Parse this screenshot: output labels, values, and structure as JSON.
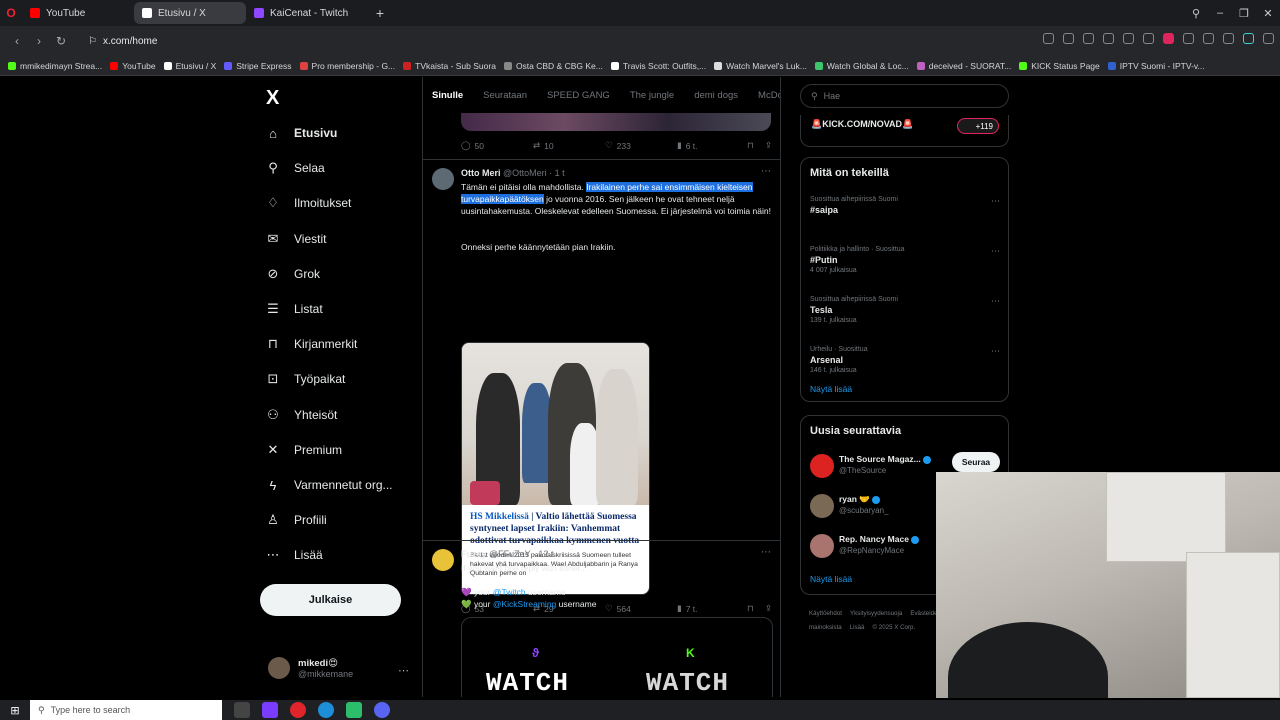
{
  "browser": {
    "tabs": [
      {
        "label": "YouTube",
        "color": "#ff0000",
        "active": false
      },
      {
        "label": "Etusivu / X",
        "color": "#ffffff",
        "active": true
      },
      {
        "label": "KaiCenat - Twitch",
        "color": "#9146ff",
        "active": false
      }
    ],
    "url": "x.com/home",
    "bookmarks": [
      {
        "label": "mmikedimayn Strea...",
        "color": "#53fc18"
      },
      {
        "label": "YouTube",
        "color": "#ff0000"
      },
      {
        "label": "Etusivu / X",
        "color": "#ffffff"
      },
      {
        "label": "Stripe Express",
        "color": "#635bff"
      },
      {
        "label": "Pro membership - G...",
        "color": "#e04040"
      },
      {
        "label": "TVkaista - Sub Suora",
        "color": "#cc2222"
      },
      {
        "label": "Osta CBD & CBG Ke...",
        "color": "#888888"
      },
      {
        "label": "Travis Scott: Outfits,...",
        "color": "#ffffff"
      },
      {
        "label": "Watch Marvel's Luk...",
        "color": "#dddddd"
      },
      {
        "label": "Watch Global & Loc...",
        "color": "#3ec46d"
      },
      {
        "label": "deceived - SUORAT...",
        "color": "#c060c0"
      },
      {
        "label": "KICK Status Page",
        "color": "#53fc18"
      },
      {
        "label": "IPTV Suomi - IPTV-v...",
        "color": "#3060d0"
      }
    ]
  },
  "nav": {
    "logo": "X",
    "items": [
      {
        "label": "Etusivu",
        "icon": "home-icon",
        "glyph": "⌂",
        "active": true
      },
      {
        "label": "Selaa",
        "icon": "search-icon",
        "glyph": "⚲"
      },
      {
        "label": "Ilmoitukset",
        "icon": "bell-icon",
        "glyph": "♢"
      },
      {
        "label": "Viestit",
        "icon": "mail-icon",
        "glyph": "✉"
      },
      {
        "label": "Grok",
        "icon": "grok-icon",
        "glyph": "⊘"
      },
      {
        "label": "Listat",
        "icon": "list-icon",
        "glyph": "☰"
      },
      {
        "label": "Kirjanmerkit",
        "icon": "bookmark-icon",
        "glyph": "⊓"
      },
      {
        "label": "Työpaikat",
        "icon": "briefcase-icon",
        "glyph": "⊡"
      },
      {
        "label": "Yhteisöt",
        "icon": "communities-icon",
        "glyph": "⚇"
      },
      {
        "label": "Premium",
        "icon": "x-icon",
        "glyph": "✕"
      },
      {
        "label": "Varmennetut org...",
        "icon": "lightning-icon",
        "glyph": "ϟ"
      },
      {
        "label": "Profiili",
        "icon": "profile-icon",
        "glyph": "♙"
      },
      {
        "label": "Lisää",
        "icon": "more-icon",
        "glyph": "⋯"
      }
    ],
    "post_label": "Julkaise",
    "account": {
      "name": "mikedi😍",
      "handle": "@mikkemane"
    }
  },
  "feed": {
    "tabs": [
      "Sinulle",
      "Seurataan",
      "SPEED GANG",
      "The jungle",
      "demi dogs",
      "McDonal"
    ],
    "top_actions": {
      "replies": "50",
      "reposts": "10",
      "likes": "233",
      "views": "6 t."
    },
    "tweet1": {
      "name": "Otto Meri",
      "handle": "@OttoMeri · 1 t",
      "text_a": "Tämän ei pitäisi olla mahdollista. ",
      "text_hl": "Irakilainen perhe sai ensimmäisen kielteisen turvapaikkapäätöksen",
      "text_b": " jo vuonna 2016. Sen jälkeen he ovat tehneet neljä uusintahakemusta. Oleskelevat edelleen Suomessa. Ei järjestelmä voi toimia näin!",
      "text_c": "Onneksi perhe käännytetään pian Irakiin.",
      "card_category": "HS Mikkelissä",
      "card_title": " | Valtio lähettää Suomessa syntyneet lapset Irakiin: Vanhemmat odottivat turvapaikkaa kymmenen vuotta",
      "card_sub": "Sadat vuoden 2015 pakolaiskriisissä Suomeen tulleet hakevat yhä turvapaikkaa. Wael Abduljabbarin ja Ranya Qubtanin perhe on",
      "actions": {
        "replies": "53",
        "reposts": "29",
        "likes": "564",
        "views": "7 t."
      }
    },
    "tweet2": {
      "name": "Fuzey",
      "handle": "@FFuZeY · 12 t",
      "line1": "If you want one reply with either...",
      "line2a": "💜 your ",
      "line2link": "@Twitch",
      "line2b": " username",
      "line3a": "💚 your ",
      "line3link": "@KickStreaming",
      "line3b": " username",
      "watch_left": "WATCH",
      "watch_right": "WATCH"
    }
  },
  "right": {
    "search_placeholder": "Hae",
    "live_text": "🚨KICK.COM/NOVAD🚨",
    "live_count": "+119",
    "trends_title": "Mitä on tekeillä",
    "trends": [
      {
        "meta": "Suosittua aihepiirissä Suomi",
        "name": "#saipa",
        "count": ""
      },
      {
        "meta": "Politiikka ja hallinto · Suosittua",
        "name": "#Putin",
        "count": "4 007 julkaisua"
      },
      {
        "meta": "Suosittua aihepiirissä Suomi",
        "name": "Tesla",
        "count": "139 t. julkaisua"
      },
      {
        "meta": "Urheilu · Suosittua",
        "name": "Arsenal",
        "count": "146 t. julkaisua"
      }
    ],
    "show_more": "Näytä lisää",
    "who_title": "Uusia seurattavia",
    "who": [
      {
        "name": "The Source Magaz...",
        "handle": "@TheSource",
        "color": "#d22"
      },
      {
        "name": "ryan 🤝",
        "handle": "@scubaryan_",
        "color": "#7a6a55"
      },
      {
        "name": "Rep. Nancy Mace",
        "handle": "@RepNancyMace",
        "color": "#a9746e"
      }
    ],
    "follow_label": "Seuraa",
    "footer": [
      "Käyttöehdot",
      "Yksityisyydensuoja",
      "Evästeiden",
      "Esteettömyys",
      "Tietoa mainoksista",
      "Lisää",
      "© 2025 X Corp."
    ]
  },
  "taskbar": {
    "search_placeholder": "Type here to search"
  }
}
